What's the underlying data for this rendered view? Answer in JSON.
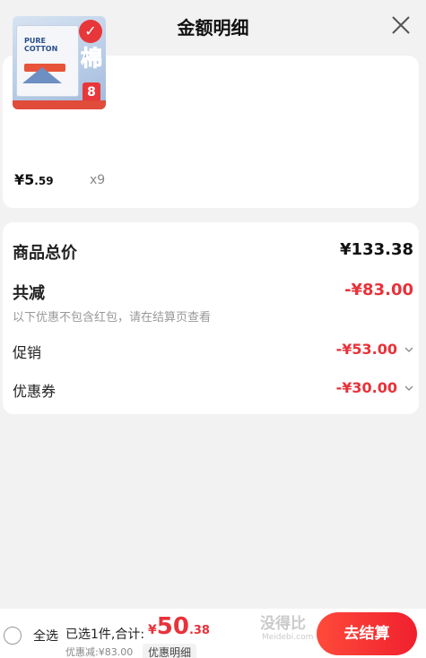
{
  "header": {
    "title": "金额明细"
  },
  "goods": {
    "price_symbol": "¥",
    "price_int": "5",
    "price_dec": ".59",
    "quantity": "x9",
    "image": {
      "badge": "✓",
      "big_text": "棉",
      "num": "8"
    }
  },
  "detail": {
    "total_label": "商品总价",
    "total_value": "¥133.38",
    "reduce_label": "共减",
    "reduce_value": "-¥83.00",
    "note": "以下优惠不包含红包，请在结算页查看",
    "promo_label": "促销",
    "promo_value": "-¥53.00",
    "coupon_label": "优惠券",
    "coupon_value": "-¥30.00"
  },
  "bottom": {
    "select_all": "全选",
    "selected": "已选1件,合计:",
    "sum_currency": "¥",
    "sum_int": "50",
    "sum_dec": ".38",
    "reduce_line": "优惠减:¥83.00",
    "detail_link": "优惠明细",
    "checkout": "去结算"
  },
  "watermark": {
    "main": "没得比",
    "sub": "Meidebi.com"
  },
  "colors": {
    "accent": "#e8323a",
    "background": "#f2f2f2"
  }
}
